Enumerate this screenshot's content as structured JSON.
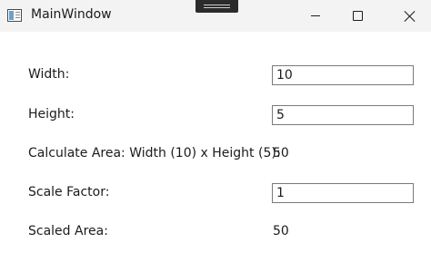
{
  "window": {
    "title": "MainWindow",
    "icon": "app-window-icon"
  },
  "caption_buttons": {
    "minimize_icon": "minimize-icon",
    "maximize_icon": "maximize-icon",
    "close_icon": "close-icon"
  },
  "form": {
    "width_label": "Width:",
    "width_value": "10",
    "height_label": "Height:",
    "height_value": "5",
    "area_label": "Calculate Area: Width (10) x Height (5):",
    "area_value": "50",
    "scale_label": "Scale Factor:",
    "scale_value": "1",
    "scaled_area_label": "Scaled Area:",
    "scaled_area_value": "50"
  }
}
